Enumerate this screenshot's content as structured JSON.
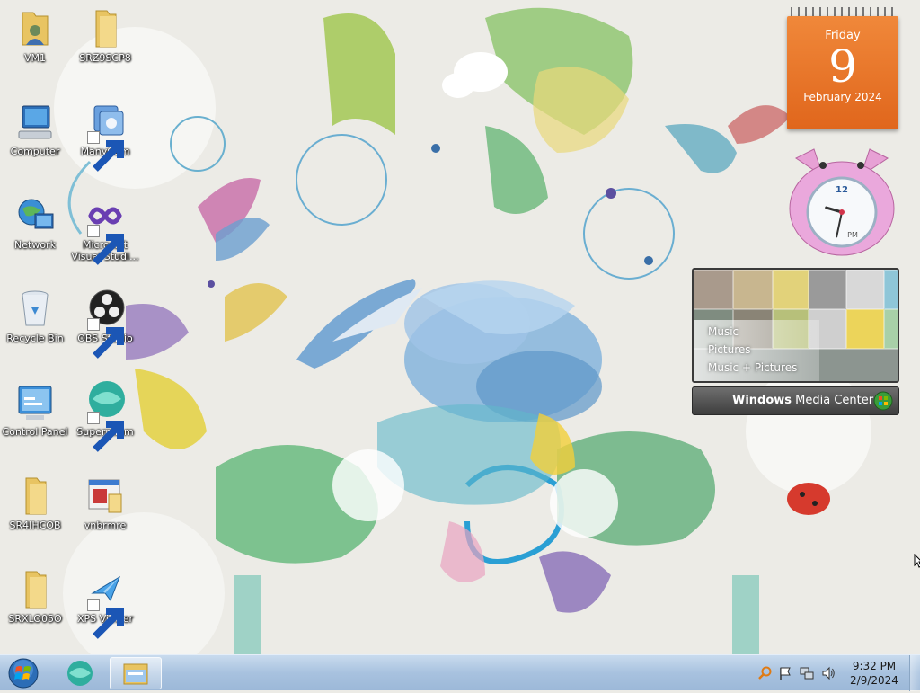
{
  "desktop": {
    "icons": [
      {
        "label": "VM1",
        "icon": "user-folder-icon"
      },
      {
        "label": "SRZ9SCP8",
        "icon": "folder-icon"
      },
      {
        "label": "Computer",
        "icon": "computer-icon"
      },
      {
        "label": "ManyCam",
        "icon": "manycam-icon"
      },
      {
        "label": "Network",
        "icon": "network-icon"
      },
      {
        "label": "Microsoft Visual Studi...",
        "icon": "visual-studio-icon"
      },
      {
        "label": "Recycle Bin",
        "icon": "recycle-bin-icon"
      },
      {
        "label": "OBS Studio",
        "icon": "obs-icon"
      },
      {
        "label": "Control Panel",
        "icon": "control-panel-icon"
      },
      {
        "label": "Supermium",
        "icon": "supermium-icon"
      },
      {
        "label": "SR4IHCOB",
        "icon": "folder-icon"
      },
      {
        "label": "vnbrmre",
        "icon": "installer-icon"
      },
      {
        "label": "SRXLO05O",
        "icon": "folder-icon"
      },
      {
        "label": "XPS Viewer",
        "icon": "xps-viewer-icon"
      }
    ]
  },
  "calendar_gadget": {
    "day_of_week": "Friday",
    "day": "9",
    "month_year": "February 2024"
  },
  "clock_gadget": {
    "twelve_label": "12",
    "am_pm": "PM",
    "hour": 9,
    "minute": 32
  },
  "media_center_gadget": {
    "menu": [
      "Music",
      "Pictures",
      "Music + Pictures"
    ],
    "brand_bold": "Windows",
    "brand_rest": " Media Center"
  },
  "taskbar": {
    "pinned": [
      {
        "name": "supermium",
        "icon": "supermium-icon"
      },
      {
        "name": "windows-explorer",
        "icon": "explorer-folder-icon"
      }
    ],
    "tray_icons": [
      "search-icon",
      "flag-icon",
      "network-icon",
      "volume-icon"
    ],
    "time": "9:32 PM",
    "date": "2/9/2024"
  },
  "colors": {
    "calendar_orange": "#e0661c",
    "taskbar_blue": "#a8c2df",
    "wallpaper_bg": "#ecebe6"
  }
}
